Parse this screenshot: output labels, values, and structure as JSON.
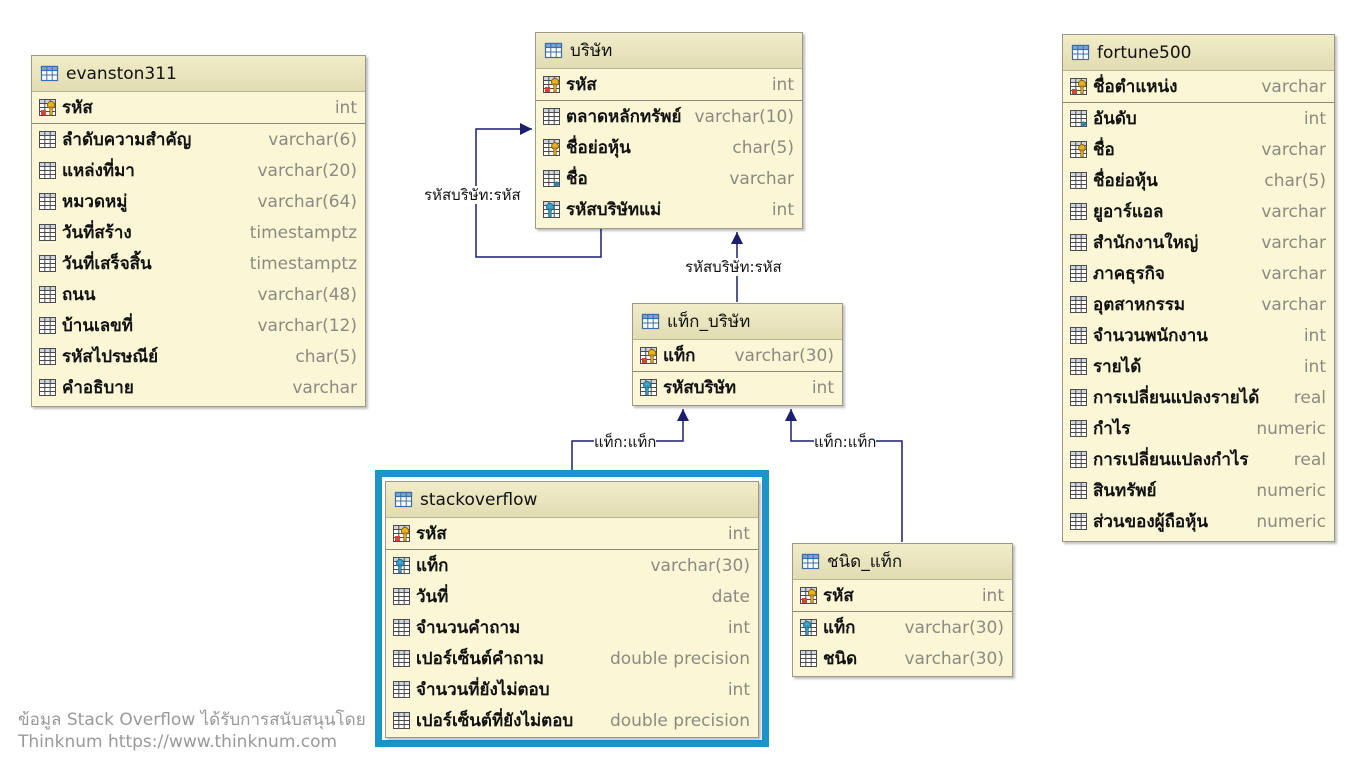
{
  "tables": {
    "evanston": {
      "name": "evanston311",
      "pk": [
        {
          "name": "รหัส",
          "type": "int",
          "icon": "primary-key-icon"
        }
      ],
      "cols": [
        {
          "name": "ลำดับความสำคัญ",
          "type": "varchar(6)",
          "icon": "column-icon"
        },
        {
          "name": "แหล่งที่มา",
          "type": "varchar(20)",
          "icon": "column-icon"
        },
        {
          "name": "หมวดหมู่",
          "type": "varchar(64)",
          "icon": "column-icon"
        },
        {
          "name": "วันที่สร้าง",
          "type": "timestamptz",
          "icon": "column-icon"
        },
        {
          "name": "วันที่เสร็จสิ้น",
          "type": "timestamptz",
          "icon": "column-icon"
        },
        {
          "name": "ถนน",
          "type": "varchar(48)",
          "icon": "column-icon"
        },
        {
          "name": "บ้านเลขที่",
          "type": "varchar(12)",
          "icon": "column-icon"
        },
        {
          "name": "รหัสไปรษณีย์",
          "type": "char(5)",
          "icon": "column-icon"
        },
        {
          "name": "คำอธิบาย",
          "type": "varchar",
          "icon": "column-icon"
        }
      ]
    },
    "company": {
      "name": "บริษัท",
      "pk": [
        {
          "name": "รหัส",
          "type": "int",
          "icon": "primary-key-icon"
        }
      ],
      "cols": [
        {
          "name": "ตลาดหลักทรัพย์",
          "type": "varchar(10)",
          "icon": "column-icon"
        },
        {
          "name": "ชื่อย่อหุ้น",
          "type": "char(5)",
          "icon": "unique-key-icon"
        },
        {
          "name": "ชื่อ",
          "type": "varchar",
          "icon": "not-null-column-icon"
        },
        {
          "name": "รหัสบริษัทแม่",
          "type": "int",
          "icon": "foreign-key-icon"
        }
      ]
    },
    "tag_company": {
      "name": "แท็ก_บริษัท",
      "pk": [
        {
          "name": "แท็ก",
          "type": "varchar(30)",
          "icon": "primary-key-icon"
        }
      ],
      "cols": [
        {
          "name": "รหัสบริษัท",
          "type": "int",
          "icon": "foreign-key-icon"
        }
      ]
    },
    "stackoverflow": {
      "name": "stackoverflow",
      "pk": [
        {
          "name": "รหัส",
          "type": "int",
          "icon": "primary-key-icon"
        }
      ],
      "cols": [
        {
          "name": "แท็ก",
          "type": "varchar(30)",
          "icon": "foreign-key-icon"
        },
        {
          "name": "วันที่",
          "type": "date",
          "icon": "column-icon"
        },
        {
          "name": "จำนวนคำถาม",
          "type": "int",
          "icon": "column-icon"
        },
        {
          "name": "เปอร์เซ็นต์คำถาม",
          "type": "double precision",
          "icon": "column-icon"
        },
        {
          "name": "จำนวนที่ยังไม่ตอบ",
          "type": "int",
          "icon": "column-icon"
        },
        {
          "name": "เปอร์เซ็นต์ที่ยังไม่ตอบ",
          "type": "double precision",
          "icon": "column-icon"
        }
      ]
    },
    "tag_type": {
      "name": "ชนิด_แท็ก",
      "pk": [
        {
          "name": "รหัส",
          "type": "int",
          "icon": "primary-key-icon"
        }
      ],
      "cols": [
        {
          "name": "แท็ก",
          "type": "varchar(30)",
          "icon": "foreign-key-icon"
        },
        {
          "name": "ชนิด",
          "type": "varchar(30)",
          "icon": "column-icon"
        }
      ]
    },
    "fortune": {
      "name": "fortune500",
      "pk": [
        {
          "name": "ชื่อตำแหน่ง",
          "type": "varchar",
          "icon": "primary-key-icon"
        }
      ],
      "cols": [
        {
          "name": "อันดับ",
          "type": "int",
          "icon": "not-null-column-icon"
        },
        {
          "name": "ชื่อ",
          "type": "varchar",
          "icon": "unique-key-icon"
        },
        {
          "name": "ชื่อย่อหุ้น",
          "type": "char(5)",
          "icon": "column-icon"
        },
        {
          "name": "ยูอาร์แอล",
          "type": "varchar",
          "icon": "column-icon"
        },
        {
          "name": "สำนักงานใหญ่",
          "type": "varchar",
          "icon": "column-icon"
        },
        {
          "name": "ภาคธุรกิจ",
          "type": "varchar",
          "icon": "column-icon"
        },
        {
          "name": "อุตสาหกรรม",
          "type": "varchar",
          "icon": "column-icon"
        },
        {
          "name": "จำนวนพนักงาน",
          "type": "int",
          "icon": "column-icon"
        },
        {
          "name": "รายได้",
          "type": "int",
          "icon": "column-icon"
        },
        {
          "name": "การเปลี่ยนแปลงรายได้",
          "type": "real",
          "icon": "column-icon"
        },
        {
          "name": "กำไร",
          "type": "numeric",
          "icon": "column-icon"
        },
        {
          "name": "การเปลี่ยนแปลงกำไร",
          "type": "real",
          "icon": "column-icon"
        },
        {
          "name": "สินทรัพย์",
          "type": "numeric",
          "icon": "column-icon"
        },
        {
          "name": "ส่วนของผู้ถือหุ้น",
          "type": "numeric",
          "icon": "column-icon"
        }
      ]
    }
  },
  "relations": {
    "company_self": "รหัสบริษัท:รหัส",
    "tagcompany_company": "รหัสบริษัท:รหัส",
    "so_tagcompany": "แท็ก:แท็ก",
    "tagtype_tagcompany": "แท็ก:แท็ก"
  },
  "footer": {
    "line1": "ข้อมูล Stack Overflow ได้รับการสนับสนุนโดย",
    "line2": "Thinknum https://www.thinknum.com"
  },
  "colors": {
    "table_bg": "#fbf7d6",
    "line": "#1b1f6e",
    "highlight": "#1c93c9"
  }
}
